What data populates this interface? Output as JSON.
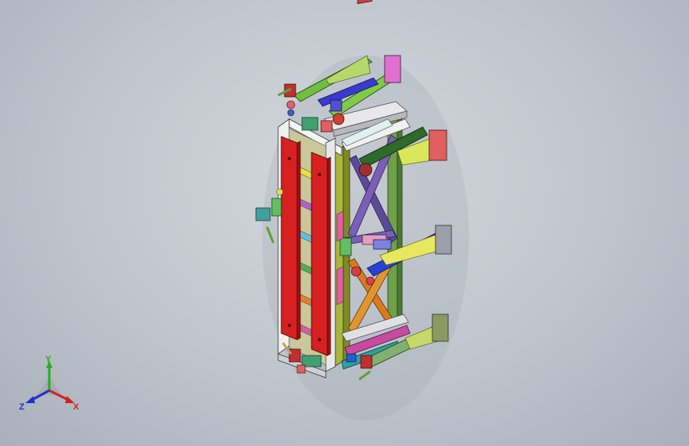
{
  "viewport": {
    "background": "#c2c8d0",
    "model": "fixture-frame-assembly"
  },
  "triad": {
    "x_label": "X",
    "y_label": "Y",
    "z_label": "Z",
    "x_color": "#d42020",
    "y_color": "#20b020",
    "z_color": "#2030d0"
  }
}
